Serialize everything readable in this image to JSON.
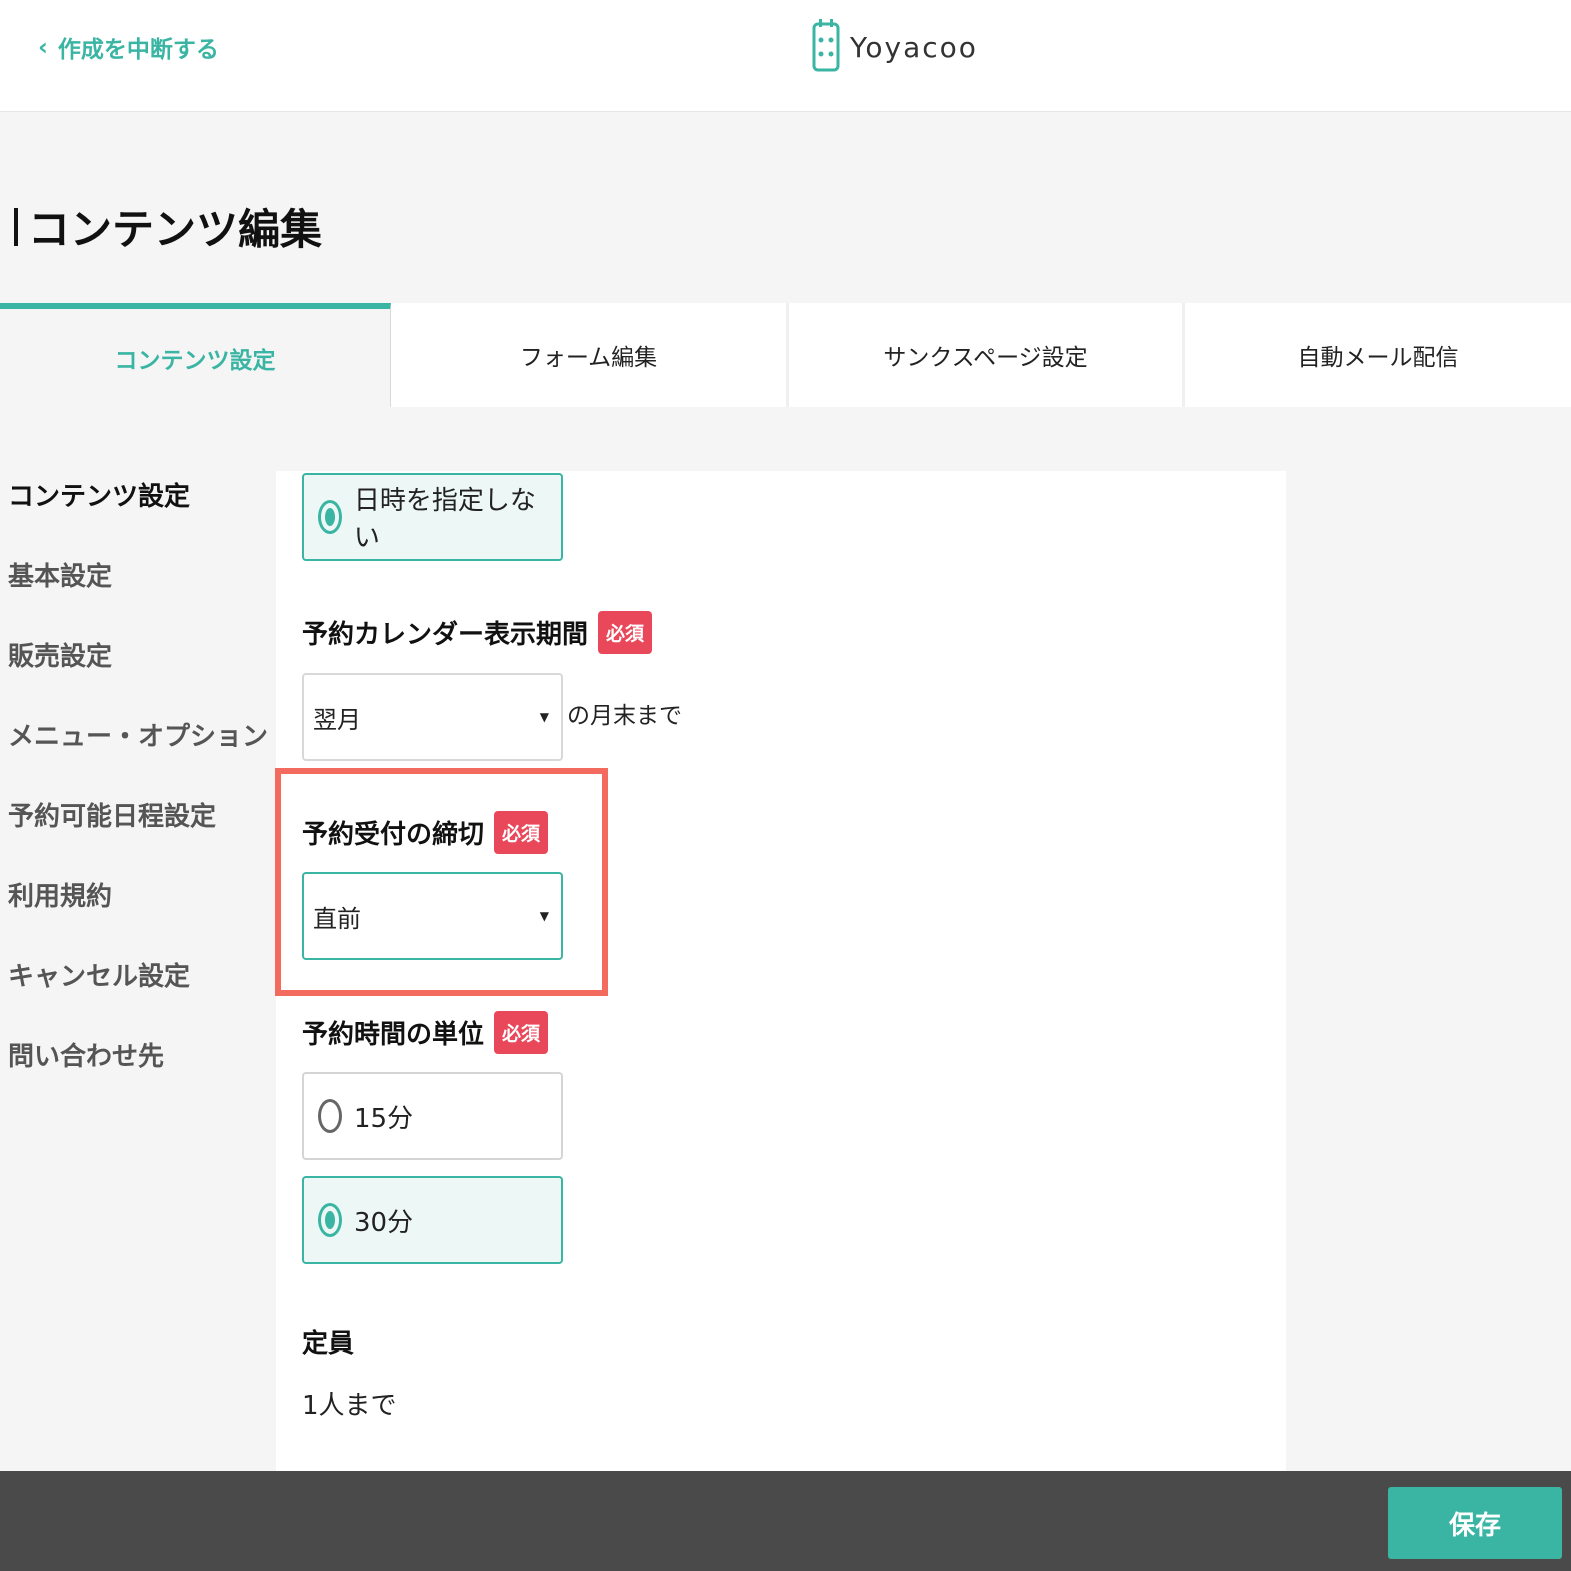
{
  "header": {
    "back_label": "作成を中断する",
    "logo_name": "Yoyacoo"
  },
  "page_title": "コンテンツ編集",
  "tabs": [
    {
      "label": "コンテンツ設定",
      "active": true
    },
    {
      "label": "フォーム編集",
      "active": false
    },
    {
      "label": "サンクスページ設定",
      "active": false
    },
    {
      "label": "自動メール配信",
      "active": false
    }
  ],
  "sidebar": {
    "items": [
      {
        "label": "コンテンツ設定",
        "active": true
      },
      {
        "label": "基本設定",
        "active": false
      },
      {
        "label": "販売設定",
        "active": false
      },
      {
        "label": "メニュー・オプション",
        "active": false
      },
      {
        "label": "予約可能日程設定",
        "active": false
      },
      {
        "label": "利用規約",
        "active": false
      },
      {
        "label": "キャンセル設定",
        "active": false
      },
      {
        "label": "問い合わせ先",
        "active": false
      }
    ]
  },
  "form": {
    "datetime_option": {
      "label": "日時を指定しない",
      "selected": true
    },
    "calendar_period": {
      "label": "予約カレンダー表示期間",
      "badge": "必須",
      "value": "翌月",
      "suffix": "の月末まで"
    },
    "deadline": {
      "label": "予約受付の締切",
      "badge": "必須",
      "value": "直前"
    },
    "time_unit": {
      "label": "予約時間の単位",
      "badge": "必須",
      "options": [
        {
          "label": "15分",
          "selected": false
        },
        {
          "label": "30分",
          "selected": true
        }
      ]
    },
    "capacity": {
      "label": "定員",
      "value": "1人まで"
    }
  },
  "footer": {
    "save_label": "保存"
  },
  "colors": {
    "accent": "#3bb5a3",
    "required_badge": "#e9485a",
    "highlight_border": "#f26b5e",
    "footer_bg": "#4a4a4a"
  },
  "icons": {
    "back": "chevron-left-icon",
    "logo": "calendar-icon",
    "select_arrow": "caret-down-icon"
  }
}
